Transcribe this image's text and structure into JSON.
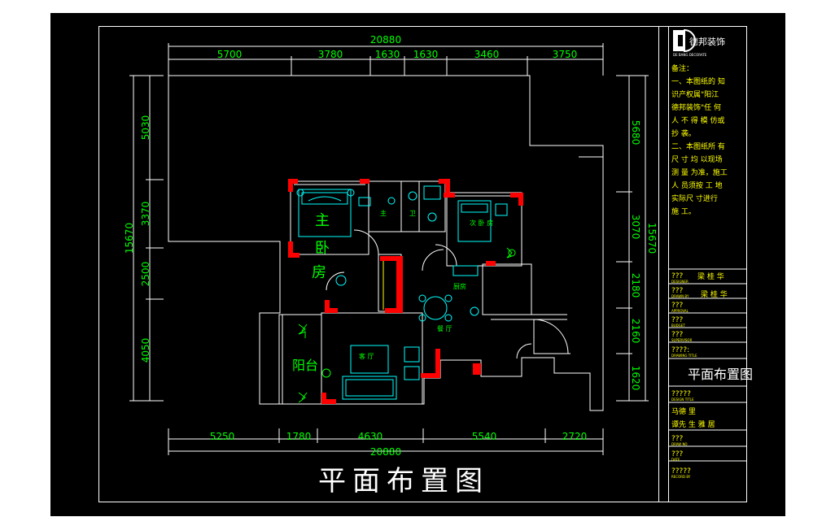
{
  "drawing_title": "平面布置图",
  "overall_width": "20880",
  "overall_height": "15670",
  "dims_top": [
    "5700",
    "3780",
    "1630",
    "1630",
    "3460",
    "3750"
  ],
  "dims_bottom": [
    "5250",
    "1780",
    "4630",
    "5540",
    "2720"
  ],
  "dims_left": [
    "5030",
    "3370",
    "2500",
    "4050"
  ],
  "dims_right": [
    "5680",
    "3070",
    "2180",
    "2160",
    "1620"
  ],
  "rooms": {
    "master_1": "主",
    "master_2": "卧",
    "master_3": "房",
    "balcony": "阳台",
    "living": "客 厅",
    "dining": "餐 厅",
    "kitchen": "厨房",
    "bath": "主",
    "second_bed": "次 卧 房",
    "wash": "卫"
  },
  "title_block": {
    "company": "德邦装饰",
    "company_en": "DE BANG DECORATE",
    "notes_title": "备注：",
    "notes": [
      "一、本图纸的 知",
      "识产权属\"阳江",
      "德邦装饰\"任 何",
      "人 不 得 模 仿或",
      "抄 袭。",
      "二、本图纸所 有",
      "尺 寸 均 以现场",
      "测 量 为准，施工",
      "人 员须按 工 地",
      "实际尺 寸进行",
      "施 工。"
    ],
    "row_designer_label": "???",
    "row_designer_sub": "DESIGNER",
    "row_designer_name": "梁 桂 华",
    "row_drawn_label": "???",
    "row_drawn_sub": "DRAWN BY",
    "row_drawn_name": "梁 桂 华",
    "row_approved_label": "???",
    "row_approved_sub": "APPROVAL",
    "row_budget_label": "???",
    "row_budget_sub": "BUDGET",
    "row_super_label": "???",
    "row_super_sub": "SUPERVISOR",
    "row_scale_label": "????:",
    "row_scale_sub": "DRAWING TITLE",
    "sheet_name": "平面布置图",
    "row_title_label": "?????",
    "row_title_sub": "DESIGN TITLE",
    "client_1": "马德 里",
    "client_2": "谭先 生 雅 居",
    "row_no_label": "???",
    "row_no_sub": "DRAW NO",
    "row_date_label": "???",
    "row_date_sub": "DATE",
    "row_last_label": "?????",
    "row_last_sub": "RECORD BY"
  },
  "colors": {
    "line": "#ffffff",
    "dim": "#00ff00",
    "text": "#00ff00",
    "column": "#ff0000",
    "furniture": "#00ffff",
    "frame": "#0000ff",
    "yellow": "#ffff00"
  }
}
